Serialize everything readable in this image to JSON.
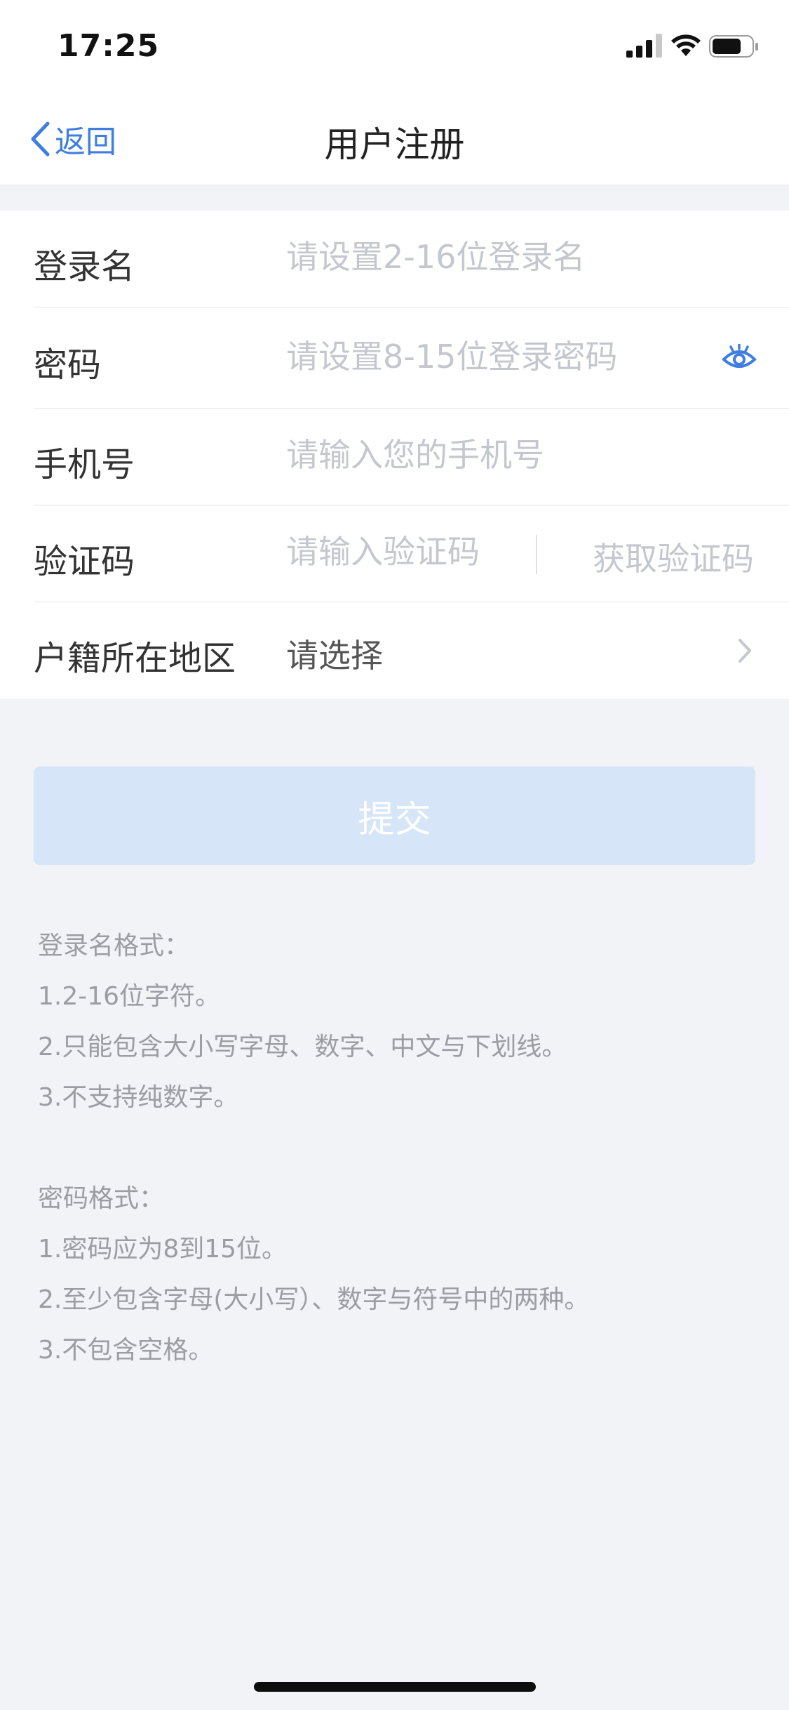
{
  "status_bar": {
    "time": "17:25"
  },
  "nav": {
    "back_label": "返回",
    "title": "用户注册"
  },
  "form": {
    "login_name": {
      "label": "登录名",
      "placeholder": "请设置2-16位登录名"
    },
    "password": {
      "label": "密码",
      "placeholder": "请设置8-15位登录密码"
    },
    "phone": {
      "label": "手机号",
      "placeholder": "请输入您的手机号"
    },
    "verify_code": {
      "label": "验证码",
      "placeholder": "请输入验证码",
      "get_code_label": "获取验证码"
    },
    "region": {
      "label": "户籍所在地区",
      "value": "请选择"
    }
  },
  "submit_label": "提交",
  "rules": {
    "login_name": {
      "heading": "登录名格式：",
      "items": [
        "1.2-16位字符。",
        "2.只能包含大小写字母、数字、中文与下划线。",
        "3.不支持纯数字。"
      ]
    },
    "password": {
      "heading": "密码格式：",
      "items": [
        "1.密码应为8到15位。",
        "2.至少包含字母(大小写）、数字与符号中的两种。",
        "3.不包含空格。"
      ]
    }
  },
  "colors": {
    "accent": "#3f7ee0",
    "background": "#f2f3f7",
    "submit_disabled": "#d6e5f7",
    "placeholder": "#c4c7cd",
    "hint_text": "#9a9da3"
  },
  "icons": [
    "signal-icon",
    "wifi-icon",
    "battery-icon",
    "chevron-left-icon",
    "eye-icon",
    "chevron-right-icon"
  ]
}
